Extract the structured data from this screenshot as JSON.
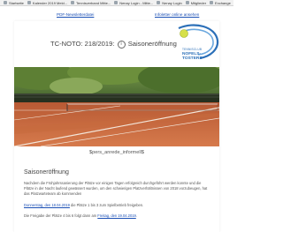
{
  "bookmarks": [
    {
      "label": "Startseite"
    },
    {
      "label": "Kalender 2019 Meld..."
    },
    {
      "label": "Tennisverband Mitte..."
    },
    {
      "label": "Nenay Login - Mitte..."
    },
    {
      "label": "Nenay Login"
    },
    {
      "label": "Mitglieder"
    },
    {
      "label": "Exchange"
    }
  ],
  "top_links": {
    "pdf": "PDF-Newsletterdatei",
    "online": "Infoletter online ansehen"
  },
  "newsletter": {
    "title_prefix": "TC-NOTO: 218/2019:",
    "info_glyph": "i",
    "title_suffix": "Saisoneröffnung",
    "logo_line1": "TENNISCLUB",
    "logo_line2": "NOFELS-TOSTERS",
    "wildcard": "$pers_anrede_informell$",
    "section_title": "Saisoneröffnung",
    "para1": "Nachdem die Frühjahrssanierung der Plätze vor einigen Tagen erfolgreich durchgeführt werden konnte und die Plätze in der Nacht laufend gewässert wurden, um den schwierigen Platzverhältnissen von 2018 vorzubeugen, hat das Platzwarteteam ab kommenden",
    "para2_link": "Donnerstag, den 18.04.2019",
    "para2_rest": " die Plätze 1 bis 3 zum Spielbetrieb freigeben.",
    "para3_start": "Die Freigabe der Plätze 4 bis 6 folgt dann am ",
    "para3_link": "Freitag, den 19.04.2019",
    "para3_end": "."
  },
  "colors": {
    "link": "#1a4fb5",
    "clay": "#c8633a",
    "brand": "#2b6fb8"
  }
}
